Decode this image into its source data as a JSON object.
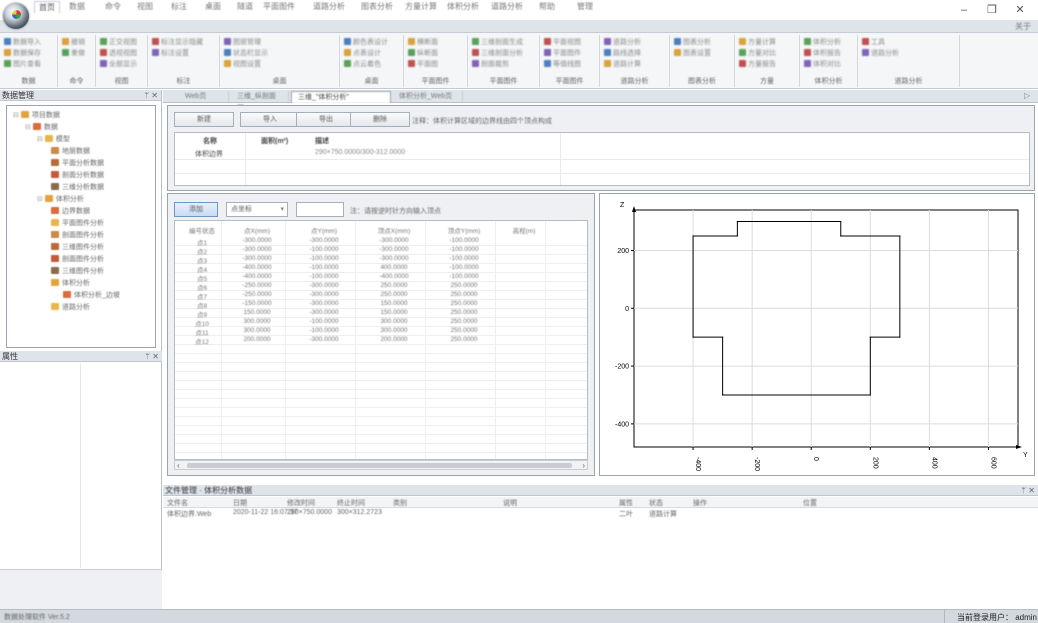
{
  "window": {
    "title_icon": "app-orb-icon",
    "minimize": "–",
    "restore": "❐",
    "close": "✕"
  },
  "ribbon_tabs": [
    "首页",
    "数据",
    "命令",
    "视图",
    "标注",
    "桌面",
    "隧道",
    "平面图件",
    "道路分析",
    "图表分析",
    "方量计算",
    "体积分析",
    "道路分析",
    "帮助",
    "管理"
  ],
  "ribbon_help": "关于",
  "ribbon_groups": [
    {
      "label": "数据",
      "items": [
        "数据导入",
        "数据保存",
        "图片查看"
      ]
    },
    {
      "label": "命令",
      "items": [
        "撤销",
        "重做"
      ]
    },
    {
      "label": "视图",
      "items": [
        "正交视图",
        "透视视图",
        "全部显示"
      ]
    },
    {
      "label": "标注",
      "items": [
        "标注显示隐藏",
        "标注设置"
      ]
    },
    {
      "label": "桌面",
      "items": [
        "图层管理",
        "状态栏显示",
        "视图设置"
      ]
    },
    {
      "label": "桌面",
      "items": [
        "颜色表设计",
        "点表设计",
        "点云着色"
      ]
    },
    {
      "label": "平面图件",
      "items": [
        "横断面",
        "纵断面",
        "平面图"
      ]
    },
    {
      "label": "平面图件",
      "items": [
        "三维剖面生成",
        "三维剖面分析",
        "剖面裁剪"
      ]
    },
    {
      "label": "平面图件",
      "items": [
        "平面视图",
        "平面图件",
        "等值线图"
      ]
    },
    {
      "label": "道路分析",
      "items": [
        "道路分析",
        "路线选择",
        "道路计算"
      ]
    },
    {
      "label": "图表分析",
      "items": [
        "图表分析",
        "图表设置"
      ]
    },
    {
      "label": "方量",
      "items": [
        "方量计算",
        "方量对比",
        "方量报告"
      ]
    },
    {
      "label": "体积分析",
      "items": [
        "体积分析",
        "体积报告",
        "体积对比"
      ]
    },
    {
      "label": "道路分析",
      "items": [
        "工具",
        "道路分析"
      ]
    }
  ],
  "left_panel": {
    "title": "数据管理",
    "tree": [
      {
        "label": "项目数据",
        "level": 0
      },
      {
        "label": "数据",
        "level": 1
      },
      {
        "label": "模型",
        "level": 2
      },
      {
        "label": "地层数据",
        "level": 3
      },
      {
        "label": "平面分析数据",
        "level": 3
      },
      {
        "label": "剖面分析数据",
        "level": 3
      },
      {
        "label": "三维分析数据",
        "level": 3
      },
      {
        "label": "体积分析",
        "level": 2
      },
      {
        "label": "边界数据",
        "level": 3
      },
      {
        "label": "平面图件分析",
        "level": 3
      },
      {
        "label": "剖面图件分析",
        "level": 3
      },
      {
        "label": "三维图件分析",
        "level": 3
      },
      {
        "label": "剖面图件分析",
        "level": 3
      },
      {
        "label": "三维图件分析",
        "level": 3
      },
      {
        "label": "体积分析",
        "level": 3
      },
      {
        "label": "体积分析_边坡",
        "level": 4
      },
      {
        "label": "道路分析",
        "level": 3
      }
    ]
  },
  "properties_panel": {
    "title": "属性"
  },
  "doc_tabs": [
    {
      "label": "Web页",
      "active": false
    },
    {
      "label": "三维_纵剖面图",
      "active": false
    },
    {
      "label": "三维_\"体积分析\"",
      "active": true
    },
    {
      "label": "体积分析_Web页",
      "active": false
    }
  ],
  "upper": {
    "buttons": [
      "新建",
      "导入",
      "导出",
      "删除"
    ],
    "hint": "注释：体积计算区域的边界线由四个顶点构成",
    "table_headers": [
      "名称",
      "面积(m²)",
      "描述"
    ],
    "table_row": [
      "体积边界",
      "2000",
      "290×750.0000/300-312.0000"
    ]
  },
  "lower_left": {
    "add_button": "添加",
    "select_value": "点坐标",
    "hint": "注：请按逆时针方向输入顶点",
    "headers": [
      "编号状态",
      "点X(mm)",
      "点Y(mm)",
      "顶点X(mm)",
      "顶点Y(mm)",
      "高程(m)"
    ],
    "rows": [
      [
        "点1",
        "-300.0000",
        "-300.0000",
        "-300.0000",
        "-100.0000",
        ""
      ],
      [
        "点2",
        "-300.0000",
        "-100.0000",
        "-300.0000",
        "-100.0000",
        ""
      ],
      [
        "点3",
        "-300.0000",
        "-100.0000",
        "-300.0000",
        "-100.0000",
        ""
      ],
      [
        "点4",
        "-400.0000",
        "-100.0000",
        "400.0000",
        "-100.0000",
        ""
      ],
      [
        "点5",
        "-400.0000",
        "-100.0000",
        "-400.0000",
        "-100.0000",
        ""
      ],
      [
        "点6",
        "-250.0000",
        "-300.0000",
        "250.0000",
        "250.0000",
        ""
      ],
      [
        "点7",
        "-250.0000",
        "-300.0000",
        "250.0000",
        "250.0000",
        ""
      ],
      [
        "点8",
        "-150.0000",
        "-300.0000",
        "150.0000",
        "250.0000",
        ""
      ],
      [
        "点9",
        "150.0000",
        "-300.0000",
        "150.0000",
        "250.0000",
        ""
      ],
      [
        "点10",
        "300.0000",
        "-100.0000",
        "300.0000",
        "250.0000",
        ""
      ],
      [
        "点11",
        "300.0000",
        "-100.0000",
        "300.0000",
        "250.0000",
        ""
      ],
      [
        "点12",
        "200.0000",
        "-300.0000",
        "200.0000",
        "250.0000",
        ""
      ]
    ]
  },
  "chart_data": {
    "type": "line",
    "series": [
      {
        "x": [
          -400,
          -400,
          -250,
          -250,
          -100,
          -100,
          100,
          100,
          300,
          300,
          200,
          200,
          -300,
          -300,
          -400
        ],
        "y": [
          250,
          -100,
          -100,
          250,
          250,
          300,
          300,
          250,
          250,
          -100,
          -100,
          -300,
          -300,
          -100,
          -100
        ],
        "closed": true
      }
    ],
    "polygon": [
      [
        -400,
        250
      ],
      [
        -250,
        250
      ],
      [
        -250,
        300
      ],
      [
        100,
        300
      ],
      [
        100,
        250
      ],
      [
        300,
        250
      ],
      [
        300,
        -100
      ],
      [
        200,
        -100
      ],
      [
        200,
        -300
      ],
      [
        -300,
        -300
      ],
      [
        -300,
        -100
      ],
      [
        -400,
        -100
      ]
    ],
    "xlabel": "Y",
    "ylabel": "Z",
    "xlim": [
      -600,
      700
    ],
    "ylim": [
      -480,
      340
    ],
    "xticks": [
      -400,
      -200,
      0,
      200,
      400,
      600
    ],
    "xtick_labels": [
      "-400",
      "-200",
      "0",
      "200",
      "400",
      "600"
    ],
    "yticks": [
      200,
      0,
      -200,
      -400
    ],
    "ytick_labels": [
      "200",
      "0",
      "-200",
      "-400"
    ],
    "grid": true
  },
  "bottom_panel": {
    "title": "文件管理 · 体积分析数据",
    "columns": [
      "文件名",
      "日期",
      "修改时间",
      "终止时间",
      "类别",
      "说明",
      "属性",
      "状态",
      "操作",
      "位置"
    ],
    "row": [
      "体积边界.Web",
      "2020-11-22 16:07:37",
      "290×750.0000",
      "300×312.2723",
      "",
      "",
      "二叶",
      "道路计算",
      "",
      ""
    ]
  },
  "statusbar": {
    "left": "数据处理软件 Ver.5.2",
    "right": "当前登录用户： admin"
  }
}
